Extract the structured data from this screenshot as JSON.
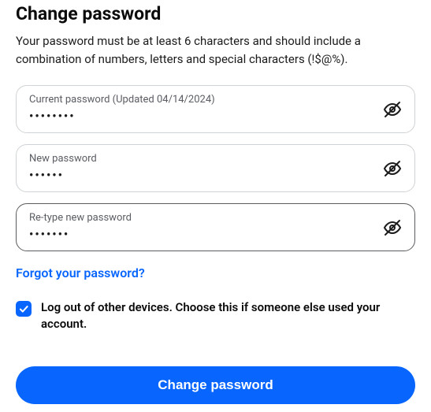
{
  "header": {
    "title": "Change password",
    "subtitle": "Your password must be at least 6 characters and should include a combination of numbers, letters and special characters (!$@%)."
  },
  "fields": {
    "current": {
      "label": "Current password (Updated 04/14/2024)",
      "value": "••••••••"
    },
    "new": {
      "label": "New password",
      "value": "••••••"
    },
    "retype": {
      "label": "Re-type new password",
      "value": "•••••••"
    }
  },
  "forgot_link": "Forgot your password?",
  "logout_checkbox": {
    "label": "Log out of other devices. Choose this if someone else used your account.",
    "checked": true
  },
  "submit_label": "Change password"
}
